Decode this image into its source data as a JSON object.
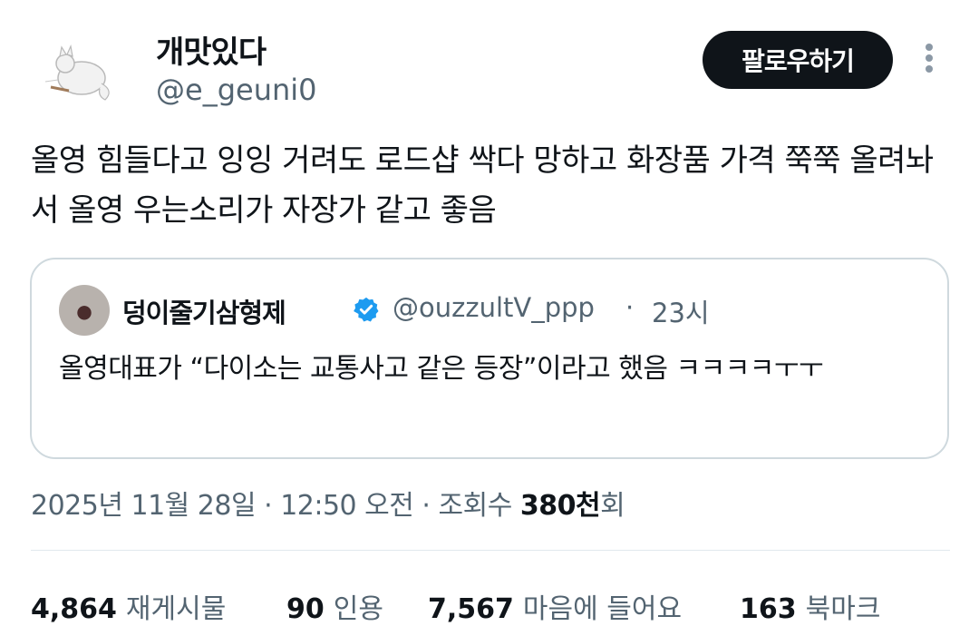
{
  "author": {
    "name": "개맛있다",
    "handle": "@e_geuni0"
  },
  "follow_button": "팔로우하기",
  "tweet_text": "올영 힘들다고 잉잉 거려도 로드샵 싹다 망하고 화장품 가격 쭉쭉 올려놔서 올영 우는소리가 자장가 같고 좋음",
  "quote": {
    "name": "덩이줄기삼형제",
    "handle": "@ouzzultV_ppp",
    "separator": "·",
    "time": "23시",
    "text": "올영대표가 “다이소는 교통사고 같은 등장”이라고 했음 ㅋㅋㅋㅋㅜㅜ"
  },
  "meta": {
    "date": "2025년 11월 28일",
    "sep1": " · ",
    "time": "12:50 오전",
    "sep2": " · ",
    "views_label": "조회수 ",
    "views_value": "380천",
    "views_suffix": "회"
  },
  "stats": {
    "retweets": {
      "value": "4,864",
      "label": "재게시물"
    },
    "quotes": {
      "value": "90",
      "label": "인용"
    },
    "likes": {
      "value": "7,567",
      "label": "마음에 들어요"
    },
    "bookmarks": {
      "value": "163",
      "label": "북마크"
    }
  },
  "colors": {
    "text": "#0f1419",
    "secondary": "#536471",
    "verified": "#1d9bf0",
    "border": "#cfd9de"
  }
}
